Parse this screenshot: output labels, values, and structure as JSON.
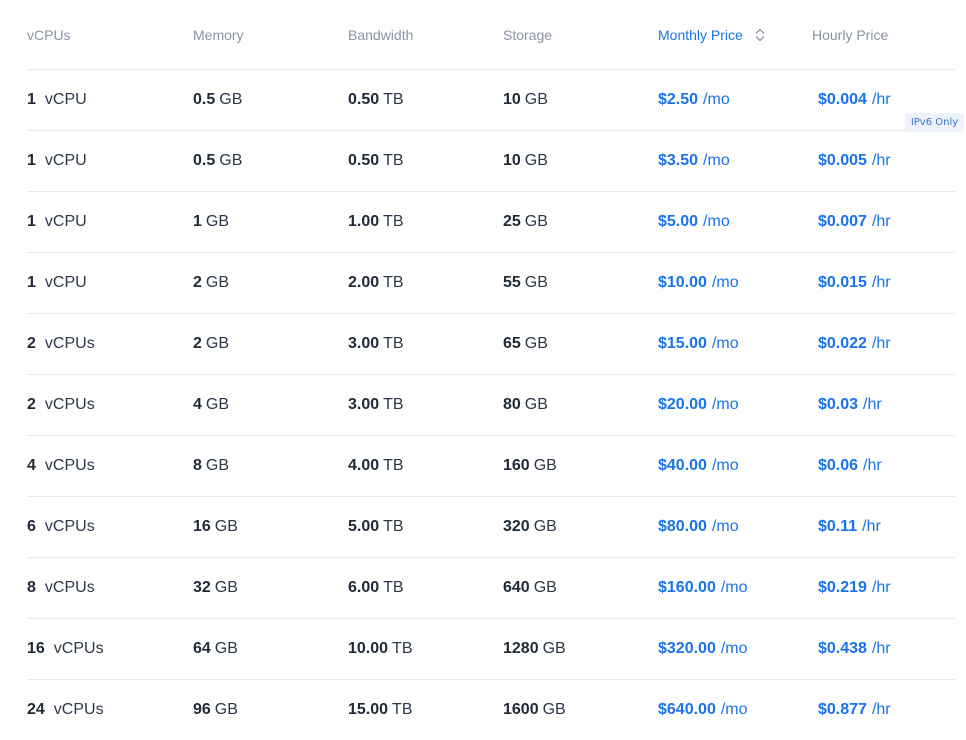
{
  "header": {
    "vcpus": "vCPUs",
    "memory": "Memory",
    "bandwidth": "Bandwidth",
    "storage": "Storage",
    "monthly": "Monthly Price",
    "hourly": "Hourly Price",
    "sort_icon": "sort-up-down-icon"
  },
  "badge": "IPv6 Only",
  "colors": {
    "accent": "#1a73e8",
    "header_text": "#8a94a6",
    "divider": "#e6e8ec",
    "badge_bg": "#eef3fb"
  },
  "rows": [
    {
      "vcpu_num": "1",
      "vcpu_unit": "vCPU",
      "mem_num": "0.5",
      "mem_unit": "GB",
      "bw_num": "0.50",
      "bw_unit": "TB",
      "st_num": "10",
      "st_unit": "GB",
      "mo_price": "$2.50",
      "mo_unit": "/mo",
      "hr_price": "$0.004",
      "hr_unit": "/hr"
    },
    {
      "vcpu_num": "1",
      "vcpu_unit": "vCPU",
      "mem_num": "0.5",
      "mem_unit": "GB",
      "bw_num": "0.50",
      "bw_unit": "TB",
      "st_num": "10",
      "st_unit": "GB",
      "mo_price": "$3.50",
      "mo_unit": "/mo",
      "hr_price": "$0.005",
      "hr_unit": "/hr"
    },
    {
      "vcpu_num": "1",
      "vcpu_unit": "vCPU",
      "mem_num": "1",
      "mem_unit": "GB",
      "bw_num": "1.00",
      "bw_unit": "TB",
      "st_num": "25",
      "st_unit": "GB",
      "mo_price": "$5.00",
      "mo_unit": "/mo",
      "hr_price": "$0.007",
      "hr_unit": "/hr"
    },
    {
      "vcpu_num": "1",
      "vcpu_unit": "vCPU",
      "mem_num": "2",
      "mem_unit": "GB",
      "bw_num": "2.00",
      "bw_unit": "TB",
      "st_num": "55",
      "st_unit": "GB",
      "mo_price": "$10.00",
      "mo_unit": "/mo",
      "hr_price": "$0.015",
      "hr_unit": "/hr"
    },
    {
      "vcpu_num": "2",
      "vcpu_unit": "vCPUs",
      "mem_num": "2",
      "mem_unit": "GB",
      "bw_num": "3.00",
      "bw_unit": "TB",
      "st_num": "65",
      "st_unit": "GB",
      "mo_price": "$15.00",
      "mo_unit": "/mo",
      "hr_price": "$0.022",
      "hr_unit": "/hr"
    },
    {
      "vcpu_num": "2",
      "vcpu_unit": "vCPUs",
      "mem_num": "4",
      "mem_unit": "GB",
      "bw_num": "3.00",
      "bw_unit": "TB",
      "st_num": "80",
      "st_unit": "GB",
      "mo_price": "$20.00",
      "mo_unit": "/mo",
      "hr_price": "$0.03",
      "hr_unit": "/hr"
    },
    {
      "vcpu_num": "4",
      "vcpu_unit": "vCPUs",
      "mem_num": "8",
      "mem_unit": "GB",
      "bw_num": "4.00",
      "bw_unit": "TB",
      "st_num": "160",
      "st_unit": "GB",
      "mo_price": "$40.00",
      "mo_unit": "/mo",
      "hr_price": "$0.06",
      "hr_unit": "/hr"
    },
    {
      "vcpu_num": "6",
      "vcpu_unit": "vCPUs",
      "mem_num": "16",
      "mem_unit": "GB",
      "bw_num": "5.00",
      "bw_unit": "TB",
      "st_num": "320",
      "st_unit": "GB",
      "mo_price": "$80.00",
      "mo_unit": "/mo",
      "hr_price": "$0.11",
      "hr_unit": "/hr"
    },
    {
      "vcpu_num": "8",
      "vcpu_unit": "vCPUs",
      "mem_num": "32",
      "mem_unit": "GB",
      "bw_num": "6.00",
      "bw_unit": "TB",
      "st_num": "640",
      "st_unit": "GB",
      "mo_price": "$160.00",
      "mo_unit": "/mo",
      "hr_price": "$0.219",
      "hr_unit": "/hr"
    },
    {
      "vcpu_num": "16",
      "vcpu_unit": "vCPUs",
      "mem_num": "64",
      "mem_unit": "GB",
      "bw_num": "10.00",
      "bw_unit": "TB",
      "st_num": "1280",
      "st_unit": "GB",
      "mo_price": "$320.00",
      "mo_unit": "/mo",
      "hr_price": "$0.438",
      "hr_unit": "/hr"
    },
    {
      "vcpu_num": "24",
      "vcpu_unit": "vCPUs",
      "mem_num": "96",
      "mem_unit": "GB",
      "bw_num": "15.00",
      "bw_unit": "TB",
      "st_num": "1600",
      "st_unit": "GB",
      "mo_price": "$640.00",
      "mo_unit": "/mo",
      "hr_price": "$0.877",
      "hr_unit": "/hr"
    }
  ]
}
